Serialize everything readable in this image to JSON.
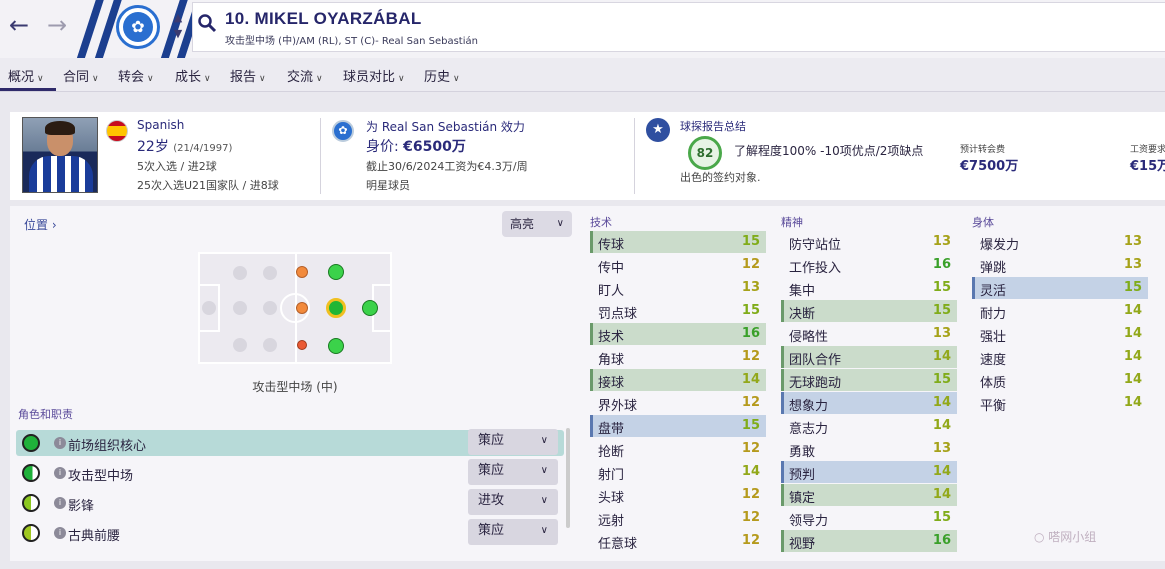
{
  "header": {
    "player_name": "10. MIKEL OYARZÁBAL",
    "player_sub": "攻击型中场 (中)/AM (RL), ST (C)- Real San Sebastián"
  },
  "tabs": [
    {
      "label": "概况"
    },
    {
      "label": "合同"
    },
    {
      "label": "转会"
    },
    {
      "label": "成长"
    },
    {
      "label": "报告"
    },
    {
      "label": "交流"
    },
    {
      "label": "球员对比"
    },
    {
      "label": "历史"
    }
  ],
  "info": {
    "nationality": "Spanish",
    "age": "22岁",
    "dob": "(21/4/1997)",
    "caps_senior": "5次入选 / 进2球",
    "caps_u21": "25次入选U21国家队 / 进8球",
    "club_line": "为 Real San Sebastián 效力",
    "value_label": "身价:",
    "value": "€6500万",
    "contract": "截止30/6/2024工资为€4.3万/周",
    "status": "明星球员",
    "scout_title": "球探报告总结",
    "scout_score": "82",
    "scout_knowledge": "了解程度100% -10项优点/2项缺点",
    "scout_desc": "出色的签约对象.",
    "fee_label": "预计转会费",
    "fee_value": "€7500万",
    "wage_label": "工资要求",
    "wage_value": "€15万"
  },
  "position": {
    "link_label": "位置",
    "highlight_label": "高亮",
    "caption": "攻击型中场 (中)"
  },
  "roles": {
    "title": "角色和职责",
    "items": [
      {
        "name": "前场组织核心",
        "duty": "策应"
      },
      {
        "name": "攻击型中场",
        "duty": "策应"
      },
      {
        "name": "影锋",
        "duty": "进攻"
      },
      {
        "name": "古典前腰",
        "duty": "策应"
      }
    ]
  },
  "attributes": {
    "technical_title": "技术",
    "mental_title": "精神",
    "physical_title": "身体",
    "technical": [
      {
        "name": "传球",
        "value": "15"
      },
      {
        "name": "传中",
        "value": "12"
      },
      {
        "name": "盯人",
        "value": "13"
      },
      {
        "name": "罚点球",
        "value": "15"
      },
      {
        "name": "技术",
        "value": "16"
      },
      {
        "name": "角球",
        "value": "12"
      },
      {
        "name": "接球",
        "value": "14"
      },
      {
        "name": "界外球",
        "value": "12"
      },
      {
        "name": "盘带",
        "value": "15"
      },
      {
        "name": "抢断",
        "value": "12"
      },
      {
        "name": "射门",
        "value": "14"
      },
      {
        "name": "头球",
        "value": "12"
      },
      {
        "name": "远射",
        "value": "12"
      },
      {
        "name": "任意球",
        "value": "12"
      }
    ],
    "mental": [
      {
        "name": "防守站位",
        "value": "13"
      },
      {
        "name": "工作投入",
        "value": "16"
      },
      {
        "name": "集中",
        "value": "15"
      },
      {
        "name": "决断",
        "value": "15"
      },
      {
        "name": "侵略性",
        "value": "13"
      },
      {
        "name": "团队合作",
        "value": "14"
      },
      {
        "name": "无球跑动",
        "value": "15"
      },
      {
        "name": "想象力",
        "value": "14"
      },
      {
        "name": "意志力",
        "value": "14"
      },
      {
        "name": "勇敢",
        "value": "13"
      },
      {
        "name": "预判",
        "value": "14"
      },
      {
        "name": "镇定",
        "value": "14"
      },
      {
        "name": "领导力",
        "value": "15"
      },
      {
        "name": "视野",
        "value": "16"
      }
    ],
    "physical": [
      {
        "name": "爆发力",
        "value": "13"
      },
      {
        "name": "弹跳",
        "value": "13"
      },
      {
        "name": "灵活",
        "value": "15"
      },
      {
        "name": "耐力",
        "value": "14"
      },
      {
        "name": "强壮",
        "value": "14"
      },
      {
        "name": "速度",
        "value": "14"
      },
      {
        "name": "体质",
        "value": "14"
      },
      {
        "name": "平衡",
        "value": "14"
      }
    ]
  },
  "colors": {
    "accent": "#26266a",
    "club_blue": "#2a6fd0",
    "highlight_green": "#cbdccb",
    "highlight_blue": "#c4d2e6",
    "role_selected": "#b7dad8"
  }
}
